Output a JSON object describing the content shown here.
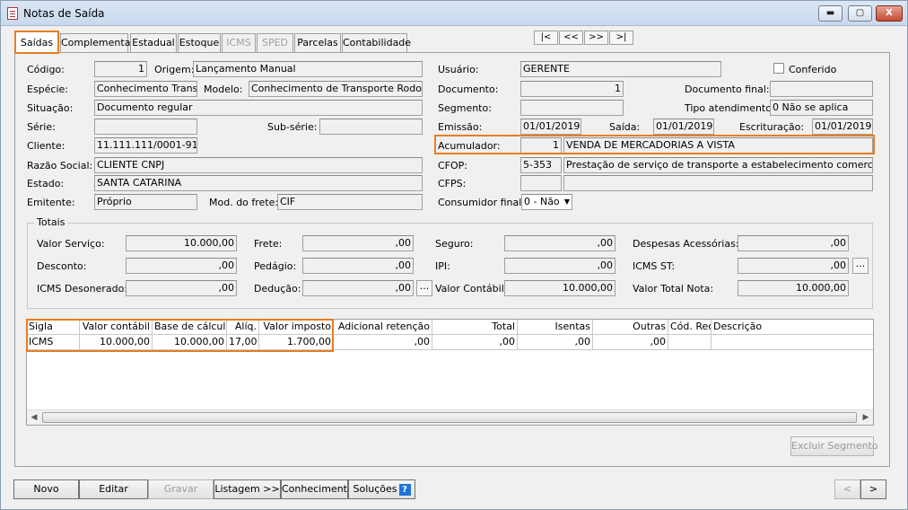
{
  "window": {
    "title": "Notas de Saída",
    "min": "▬",
    "max": "▢",
    "close": "X"
  },
  "tabs": [
    "Saídas",
    "Complementar",
    "Estadual",
    "Estoque",
    "ICMS",
    "SPED",
    "Parcelas",
    "Contabilidade"
  ],
  "nav": [
    "|<",
    "<<",
    ">>",
    ">|"
  ],
  "left": {
    "codigo_label": "Código:",
    "codigo": "1",
    "origem_label": "Origem:",
    "origem": "Lançamento Manual",
    "especie_label": "Espécie:",
    "especie": "Conhecimento Transp. R",
    "modelo_label": "Modelo:",
    "modelo": "Conhecimento de Transporte Rodoviário",
    "situacao_label": "Situação:",
    "situacao": "Documento regular",
    "serie_label": "Série:",
    "serie": "",
    "subserie_label": "Sub-série:",
    "subserie": "",
    "cliente_label": "Cliente:",
    "cliente": "11.111.111/0001-91",
    "razao_label": "Razão Social:",
    "razao": "CLIENTE CNPJ",
    "estado_label": "Estado:",
    "estado": "SANTA CATARINA",
    "emitente_label": "Emitente:",
    "emitente": "Próprio",
    "frete_label": "Mod. do frete:",
    "frete": "CIF"
  },
  "right": {
    "usuario_label": "Usuário:",
    "usuario": "GERENTE",
    "conferido_label": "Conferido",
    "documento_label": "Documento:",
    "documento": "1",
    "docfinal_label": "Documento final:",
    "docfinal": "",
    "segmento_label": "Segmento:",
    "segmento": "",
    "tipo_label": "Tipo atendimento:",
    "tipo": "0 Não se aplica",
    "emissao_label": "Emissão:",
    "emissao": "01/01/2019",
    "saida_label": "Saída:",
    "saida": "01/01/2019",
    "escrit_label": "Escrituração:",
    "escrit": "01/01/2019",
    "acum_label": "Acumulador:",
    "acum_code": "1",
    "acum_desc": "VENDA DE MERCADORIAS A VISTA",
    "cfop_label": "CFOP:",
    "cfop_code": "5-353",
    "cfop_desc": "Prestação de serviço de transporte a estabelecimento comercial",
    "cfps_label": "CFPS:",
    "cfps_code": "",
    "cfps_desc": "",
    "consumidor_label": "Consumidor final:",
    "consumidor": "0 - Não"
  },
  "totais": {
    "title": "Totais",
    "valor_servico_label": "Valor Serviço:",
    "valor_servico": "10.000,00",
    "frete_label": "Frete:",
    "frete": ",00",
    "seguro_label": "Seguro:",
    "seguro": ",00",
    "despesas_label": "Despesas Acessórias:",
    "despesas": ",00",
    "desconto_label": "Desconto:",
    "desconto": ",00",
    "pedagio_label": "Pedágio:",
    "pedagio": ",00",
    "ipi_label": "IPI:",
    "ipi": ",00",
    "icms_st_label": "ICMS ST:",
    "icms_st": ",00",
    "icms_des_label": "ICMS Desonerado:",
    "icms_des": ",00",
    "deducao_label": "Dedução:",
    "deducao": ",00",
    "valor_contabil_label": "Valor Contábil:",
    "valor_contabil": "10.000,00",
    "valor_total_label": "Valor Total Nota:",
    "valor_total": "10.000,00"
  },
  "grid": {
    "headers": [
      "Sigla",
      "Valor contábil",
      "Base de cálculo",
      "Alíq.",
      "Valor imposto",
      "Adicional retenção",
      "Total",
      "Isentas",
      "Outras",
      "Cód. Rec",
      "Descrição"
    ],
    "row": [
      "ICMS",
      "10.000,00",
      "10.000,00",
      "17,00",
      "1.700,00",
      ",00",
      ",00",
      ",00",
      ",00",
      "",
      ""
    ]
  },
  "excluir": "Excluir Segmento",
  "buttons": {
    "novo": "Novo",
    "editar": "Editar",
    "gravar": "Gravar",
    "listagem": "Listagem >>",
    "conhecimento": "Conhecimento",
    "solucoes": "Soluções",
    "help": "?",
    "prev": "<",
    "next": ">"
  }
}
